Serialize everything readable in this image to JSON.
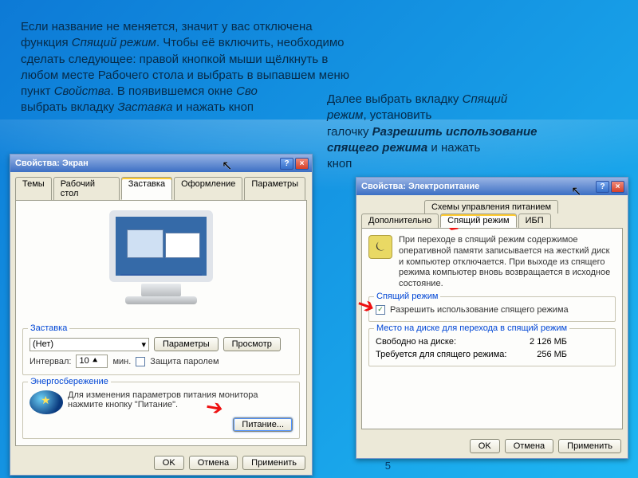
{
  "intro": {
    "line1a": "Если название не меняется, значит у вас отключена",
    "line2a": "функция ",
    "line2b": "Спящий режим",
    "line2c": ". Чтобы её включить, необходимо",
    "line3": "сделать следующее: правой кнопкой мыши щёлкнуть в",
    "line4": "любом месте Рабочего стола и выбрать в выпавшем меню",
    "line5a": "пункт ",
    "line5b": "Свойства",
    "line5c": ". В появившемся окне ",
    "line5d": "Сво",
    "line6a": "выбрать вкладку ",
    "line6b": "Заставка",
    "line6c": " и нажать кноп"
  },
  "intro2": {
    "l1a": "Далее выбрать вкладку ",
    "l1b": "Спящий",
    "l2a": "режим",
    "l2b": ", установить",
    "l3a": "галочку ",
    "l3b": "Разрешить использование",
    "l4a": "спящего режима",
    "l4b": " и нажать",
    "l5": "кноп"
  },
  "slide_number": "5",
  "win1": {
    "title": "Свойства: Экран",
    "help": "?",
    "close": "×",
    "tabs": [
      "Темы",
      "Рабочий стол",
      "Заставка",
      "Оформление",
      "Параметры"
    ],
    "saver": {
      "legend": "Заставка",
      "select_value": "(Нет)",
      "btn_params": "Параметры",
      "btn_preview": "Просмотр",
      "interval_label": "Интервал:",
      "interval_value": "10",
      "interval_units": "мин.",
      "pwd_label": "Защита паролем"
    },
    "energy": {
      "legend": "Энергосбережение",
      "text": "Для изменения параметров питания монитора нажмите кнопку \"Питание\".",
      "btn": "Питание..."
    },
    "buttons": {
      "ok": "OK",
      "cancel": "Отмена",
      "apply": "Применить"
    }
  },
  "win2": {
    "title": "Свойства: Электропитание",
    "help": "?",
    "close": "×",
    "tabs_top": [
      "Схемы управления питанием"
    ],
    "tabs_bottom": [
      "Дополнительно",
      "Спящий режим",
      "ИБП"
    ],
    "info_text": "При переходе в спящий режим содержимое оперативной памяти записывается на жесткий диск и компьютер отключается. При выходе из спящего режима компьютер вновь возвращается в исходное состояние.",
    "sleep": {
      "legend": "Спящий режим",
      "check_label": "Разрешить использование спящего режима"
    },
    "disk": {
      "legend": "Место на диске для перехода в спящий режим",
      "free_label": "Свободно на диске:",
      "free_value": "2 126 МБ",
      "need_label": "Требуется для спящего режима:",
      "need_value": "256 МБ"
    },
    "buttons": {
      "ok": "OK",
      "cancel": "Отмена",
      "apply": "Применить"
    }
  }
}
